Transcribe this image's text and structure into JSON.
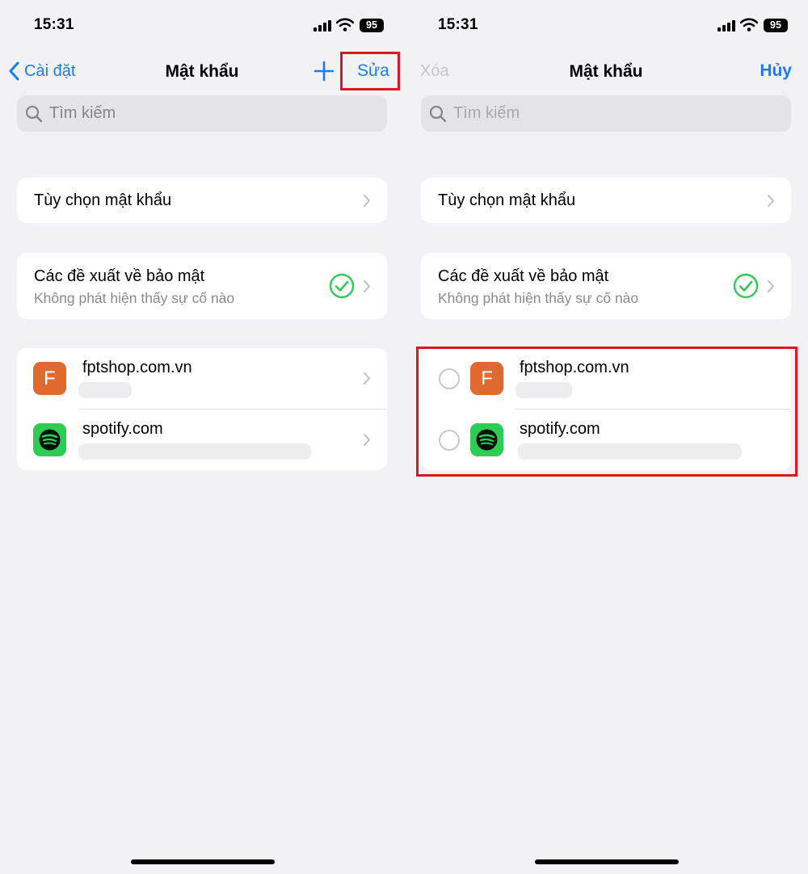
{
  "left": {
    "status": {
      "time": "15:31",
      "battery": "95"
    },
    "nav": {
      "back_label": "Cài đặt",
      "title": "Mật khẩu",
      "edit_label": "Sửa"
    },
    "search": {
      "placeholder": "Tìm kiếm"
    },
    "options": {
      "label": "Tùy chọn mật khẩu"
    },
    "security": {
      "title": "Các đề xuất về bảo mật",
      "subtitle": "Không phát hiện thấy sự cố nào"
    },
    "passwords": [
      {
        "icon_letter": "F",
        "site": "fptshop.com.vn",
        "icon": "fpt-letter-icon"
      },
      {
        "icon_letter": "",
        "site": "spotify.com",
        "icon": "spotify-icon"
      }
    ]
  },
  "right": {
    "status": {
      "time": "15:31",
      "battery": "95"
    },
    "nav": {
      "delete_label": "Xóa",
      "title": "Mật khẩu",
      "cancel_label": "Hủy"
    },
    "search": {
      "placeholder": "Tìm kiếm"
    },
    "options": {
      "label": "Tùy chọn mật khẩu"
    },
    "security": {
      "title": "Các đề xuất về bảo mật",
      "subtitle": "Không phát hiện thấy sự cố nào"
    },
    "passwords": [
      {
        "icon_letter": "F",
        "site": "fptshop.com.vn",
        "icon": "fpt-letter-icon"
      },
      {
        "icon_letter": "",
        "site": "spotify.com",
        "icon": "spotify-icon"
      }
    ]
  },
  "colors": {
    "accent": "#1a7bf5",
    "background": "#f2f1f6",
    "highlight": "#d71920",
    "check": "#34c759",
    "fpt": "#e0692f",
    "spotify": "#2dcc55"
  }
}
